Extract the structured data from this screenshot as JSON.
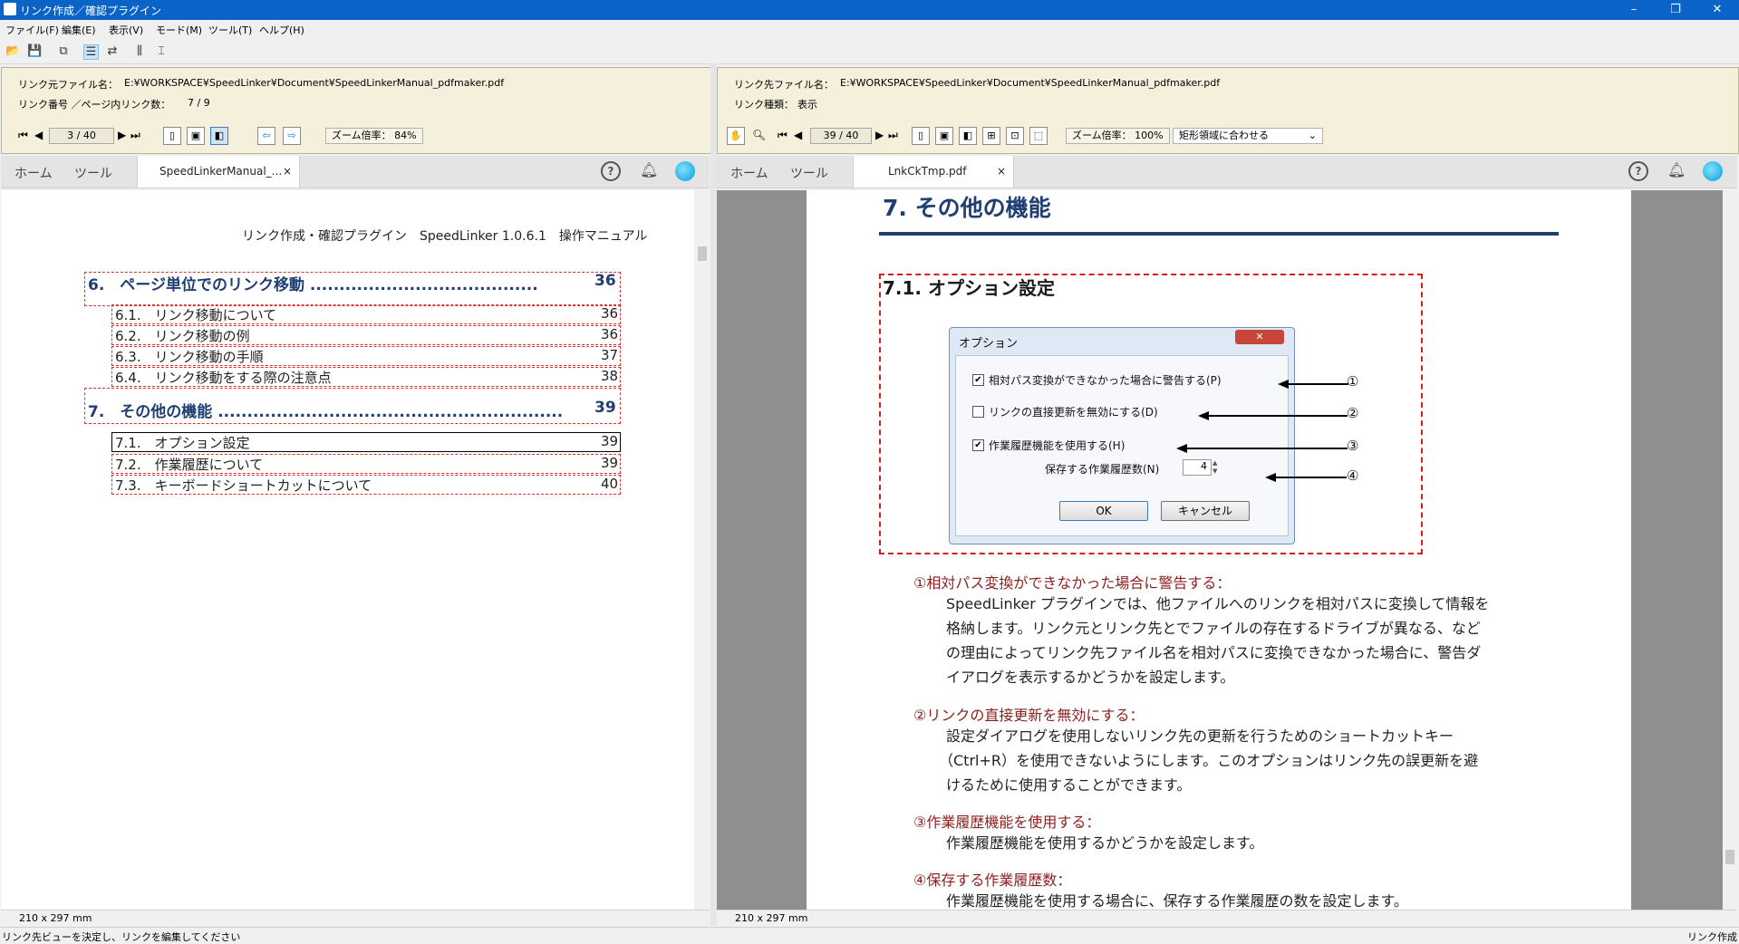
{
  "window": {
    "title": "リンク作成／確認プラグイン",
    "min": "–",
    "restore": "❐",
    "close": "✕"
  },
  "menu": [
    "ファイル(F)",
    "編集(E)",
    "表示(V)",
    "モード(M)",
    "ツール(T)",
    "ヘルプ(H)"
  ],
  "left": {
    "file_label": "リンク元ファイル名：",
    "file_path": "E:¥WORKSPACE¥SpeedLinker¥Document¥SpeedLinkerManual_pdfmaker.pdf",
    "link_label": "リンク番号 ／ページ内リンク数：",
    "link_value": "7 / 9",
    "page": "3 / 40",
    "zoom": "ズーム倍率： 84%",
    "tabs": {
      "home": "ホーム",
      "tools": "ツール",
      "doc": "SpeedLinkerManual_...",
      "close": "×"
    },
    "header": "リンク作成・確認プラグイン　SpeedLinker 1.0.6.1　操作マニュアル",
    "toc": [
      {
        "text": "6.　ページ単位でのリンク移動 .......................................",
        "page": "36",
        "big": true
      },
      {
        "text": "6.1.　リンク移動について",
        "page": "36"
      },
      {
        "text": "6.2.　リンク移動の例",
        "page": "36"
      },
      {
        "text": "6.3.　リンク移動の手順",
        "page": "37"
      },
      {
        "text": "6.4.　リンク移動をする際の注意点",
        "page": "38"
      },
      {
        "text": "7.　その他の機能 ...........................................................",
        "page": "39",
        "big": true
      },
      {
        "text": "7.1.　オプション設定",
        "page": "39"
      },
      {
        "text": "7.2.　作業履歴について",
        "page": "39"
      },
      {
        "text": "7.3.　キーボードショートカットについて",
        "page": "40"
      }
    ],
    "page_size": "210 x 297 mm"
  },
  "right": {
    "file_label": "リンク先ファイル名：",
    "file_path": "E:¥WORKSPACE¥SpeedLinker¥Document¥SpeedLinkerManual_pdfmaker.pdf",
    "type_label": "リンク種類：",
    "type_value": "表示",
    "page": "39 / 40",
    "zoom": "ズーム倍率： 100%",
    "fit": "矩形領域に合わせる",
    "tabs": {
      "home": "ホーム",
      "tools": "ツール",
      "doc": "LnkCkTmp.pdf",
      "close": "×"
    },
    "h1": "7.  その他の機能",
    "h2": "7.1.  オプション設定",
    "dialog": {
      "title": "オプション",
      "opt1": "相対パス変換ができなかった場合に警告する(P)",
      "opt2": "リンクの直接更新を無効にする(D)",
      "opt3": "作業履歴機能を使用する(H)",
      "count_label": "保存する作業履歴数(N)",
      "count_value": "4",
      "ok": "OK",
      "cancel": "キャンセル"
    },
    "markers": [
      "①",
      "②",
      "③",
      "④"
    ],
    "sections": [
      {
        "title": "①相対パス変換ができなかった場合に警告する：",
        "lines": [
          "SpeedLinker プラグインでは、他ファイルへのリンクを相対パスに変換して情報を",
          "格納します。リンク元とリンク先とでファイルの存在するドライブが異なる、など",
          "の理由によってリンク先ファイル名を相対パスに変換できなかった場合に、警告ダ",
          "イアログを表示するかどうかを設定します。"
        ]
      },
      {
        "title": "②リンクの直接更新を無効にする：",
        "lines": [
          "設定ダイアログを使用しないリンク先の更新を行うためのショートカットキー",
          "（Ctrl+R）を使用できないようにします。このオプションはリンク先の誤更新を避",
          "けるために使用することができます。"
        ]
      },
      {
        "title": "③作業履歴機能を使用する：",
        "lines": [
          "作業履歴機能を使用するかどうかを設定します。"
        ]
      },
      {
        "title": "④保存する作業履歴数：",
        "lines": [
          "作業履歴機能を使用する場合に、保存する作業履歴の数を設定します。"
        ]
      }
    ],
    "page_size": "210 x 297 mm"
  },
  "status": {
    "left": "リンク先ビューを決定し、リンクを編集してください",
    "right": "リンク作成"
  }
}
